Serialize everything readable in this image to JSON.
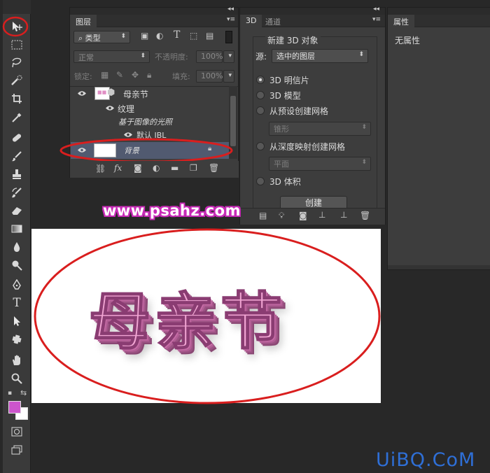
{
  "app": {
    "name": "Photoshop"
  },
  "toolbar": {
    "tools": [
      "move-icon",
      "marquee-icon",
      "lasso-icon",
      "quick-select-icon",
      "crop-icon",
      "eyedropper-icon",
      "healing-icon",
      "brush-icon",
      "stamp-icon",
      "history-brush-icon",
      "eraser-icon",
      "gradient-icon",
      "blur-icon",
      "dodge-icon",
      "pen-icon",
      "type-icon",
      "path-select-icon",
      "shape-icon",
      "hand-icon",
      "zoom-icon"
    ],
    "fg_color": "#cc55cc",
    "bg_color": "#ffffff"
  },
  "layers_panel": {
    "tab": "图层",
    "filter": "类型",
    "blend_mode": "正常",
    "opacity_label": "不透明度:",
    "opacity": "100%",
    "lock_label": "锁定:",
    "fill_label": "填充:",
    "fill": "100%",
    "layers": [
      {
        "name": "母亲节"
      },
      {
        "name": "纹理"
      },
      {
        "name": "基于图像的光照"
      },
      {
        "name": "默认 IBL"
      },
      {
        "name": "背景"
      }
    ]
  },
  "panel_3d": {
    "tabs": [
      "3D",
      "通道"
    ],
    "title": "新建 3D 对象",
    "source_label": "源:",
    "source_value": "选中的图层",
    "options": [
      {
        "label": "3D 明信片",
        "checked": true
      },
      {
        "label": "3D 模型",
        "checked": false
      },
      {
        "label": "从预设创建网格",
        "checked": false
      },
      {
        "label": "从深度映射创建网格",
        "checked": false
      },
      {
        "label": "3D 体积",
        "checked": false
      }
    ],
    "preset_value": "锥形",
    "depth_value": "平面",
    "create_button": "创建"
  },
  "properties_panel": {
    "tab": "属性",
    "empty_text": "无属性"
  },
  "watermark_site": "www.psahz.com",
  "canvas_text": "母亲节",
  "brand_watermark": "UiBQ.CoM"
}
